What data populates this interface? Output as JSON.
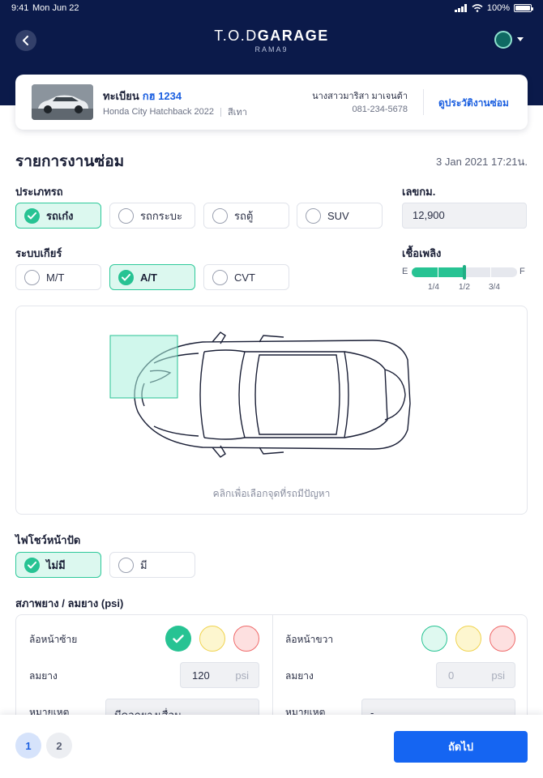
{
  "status": {
    "time": "9:41",
    "date": "Mon Jun 22",
    "battery": "100%"
  },
  "brand": {
    "prefix": "T.O.D",
    "name": "GARAGE",
    "branch": "RAMA9"
  },
  "vehicle": {
    "plate_label": "ทะเบียน",
    "plate_number": "กฮ 1234",
    "model": "Honda City Hatchback 2022",
    "color": "สีเทา",
    "owner": "นางสาวมาริสา มาเจนต้า",
    "phone": "081-234-5678",
    "history_link": "ดูประวัติงานซ่อม"
  },
  "page": {
    "title": "รายการงานซ่อม",
    "datetime": "3 Jan 2021 17:21น."
  },
  "car_type": {
    "label": "ประเภทรถ",
    "options": [
      "รถเก๋ง",
      "รถกระบะ",
      "รถตู้",
      "SUV"
    ],
    "selected": "รถเก๋ง"
  },
  "mileage": {
    "label": "เลขกม.",
    "value": "12,900"
  },
  "gear": {
    "label": "ระบบเกียร์",
    "options": [
      "M/T",
      "A/T",
      "CVT"
    ],
    "selected": "A/T"
  },
  "fuel": {
    "label": "เชื้อเพลิง",
    "empty": "E",
    "full": "F",
    "marks": [
      "1/4",
      "1/2",
      "3/4"
    ],
    "level": 0.5
  },
  "diagram": {
    "hint": "คลิกเพื่อเลือกจุดที่รถมีปัญหา"
  },
  "dashboard_light": {
    "label": "ไฟโชว์หน้าปัด",
    "options": [
      "ไม่มี",
      "มี"
    ],
    "selected": "ไม่มี"
  },
  "tires": {
    "label": "สภาพยาง / ลมยาง (psi)",
    "left": {
      "title": "ล้อหน้าซ้าย",
      "pressure_label": "ลมยาง",
      "pressure": "120",
      "unit": "psi",
      "note_label": "หมายเหตุ",
      "note": "มีดอกยางเสื่อม",
      "condition": "good"
    },
    "right": {
      "title": "ล้อหน้าขวา",
      "pressure_label": "ลมยาง",
      "pressure_placeholder": "0",
      "unit": "psi",
      "note_label": "หมายเหตุ",
      "note": "-",
      "condition": "none"
    }
  },
  "footer": {
    "pages": [
      "1",
      "2"
    ],
    "current_page": "1",
    "next": "ถัดไป"
  },
  "colors": {
    "navy": "#0b1a4a",
    "accent_green": "#27c393",
    "primary_blue": "#1565f2"
  }
}
